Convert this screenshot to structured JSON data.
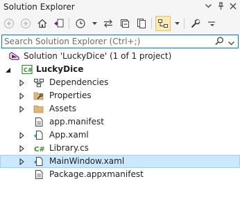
{
  "window": {
    "title": "Solution Explorer"
  },
  "search": {
    "placeholder": "Search Solution Explorer (Ctrl+;)"
  },
  "tree": [
    {
      "label": "Solution 'LuckyDice' (1 of 1 project)",
      "icon": "solution-icon",
      "bold": false,
      "expander": "none",
      "indent": 0,
      "selected": false
    },
    {
      "label": "LuckyDice",
      "icon": "csharp-project-icon",
      "bold": true,
      "expander": "expanded",
      "indent": 1,
      "selected": false
    },
    {
      "label": "Dependencies",
      "icon": "dependencies-icon",
      "bold": false,
      "expander": "collapsed",
      "indent": 2,
      "selected": false
    },
    {
      "label": "Properties",
      "icon": "properties-folder-icon",
      "bold": false,
      "expander": "collapsed",
      "indent": 2,
      "selected": false
    },
    {
      "label": "Assets",
      "icon": "folder-icon",
      "bold": false,
      "expander": "collapsed",
      "indent": 2,
      "selected": false
    },
    {
      "label": "app.manifest",
      "icon": "manifest-icon",
      "bold": false,
      "expander": "none",
      "indent": 2,
      "selected": false
    },
    {
      "label": "App.xaml",
      "icon": "xaml-file-icon",
      "bold": false,
      "expander": "collapsed",
      "indent": 2,
      "selected": false
    },
    {
      "label": "Library.cs",
      "icon": "csharp-file-icon",
      "bold": false,
      "expander": "collapsed",
      "indent": 2,
      "selected": false
    },
    {
      "label": "MainWindow.xaml",
      "icon": "xaml-file-icon",
      "bold": false,
      "expander": "collapsed",
      "indent": 2,
      "selected": true
    },
    {
      "label": "Package.appxmanifest",
      "icon": "manifest-icon",
      "bold": false,
      "expander": "none",
      "indent": 2,
      "selected": false
    }
  ],
  "colors": {
    "accent": "#007acc",
    "selection_bg": "#cce8ff",
    "selection_border": "#99d1ff",
    "csharp_green": "#388a34",
    "vs_purple": "#68217a",
    "folder_tan": "#dcb67a"
  }
}
